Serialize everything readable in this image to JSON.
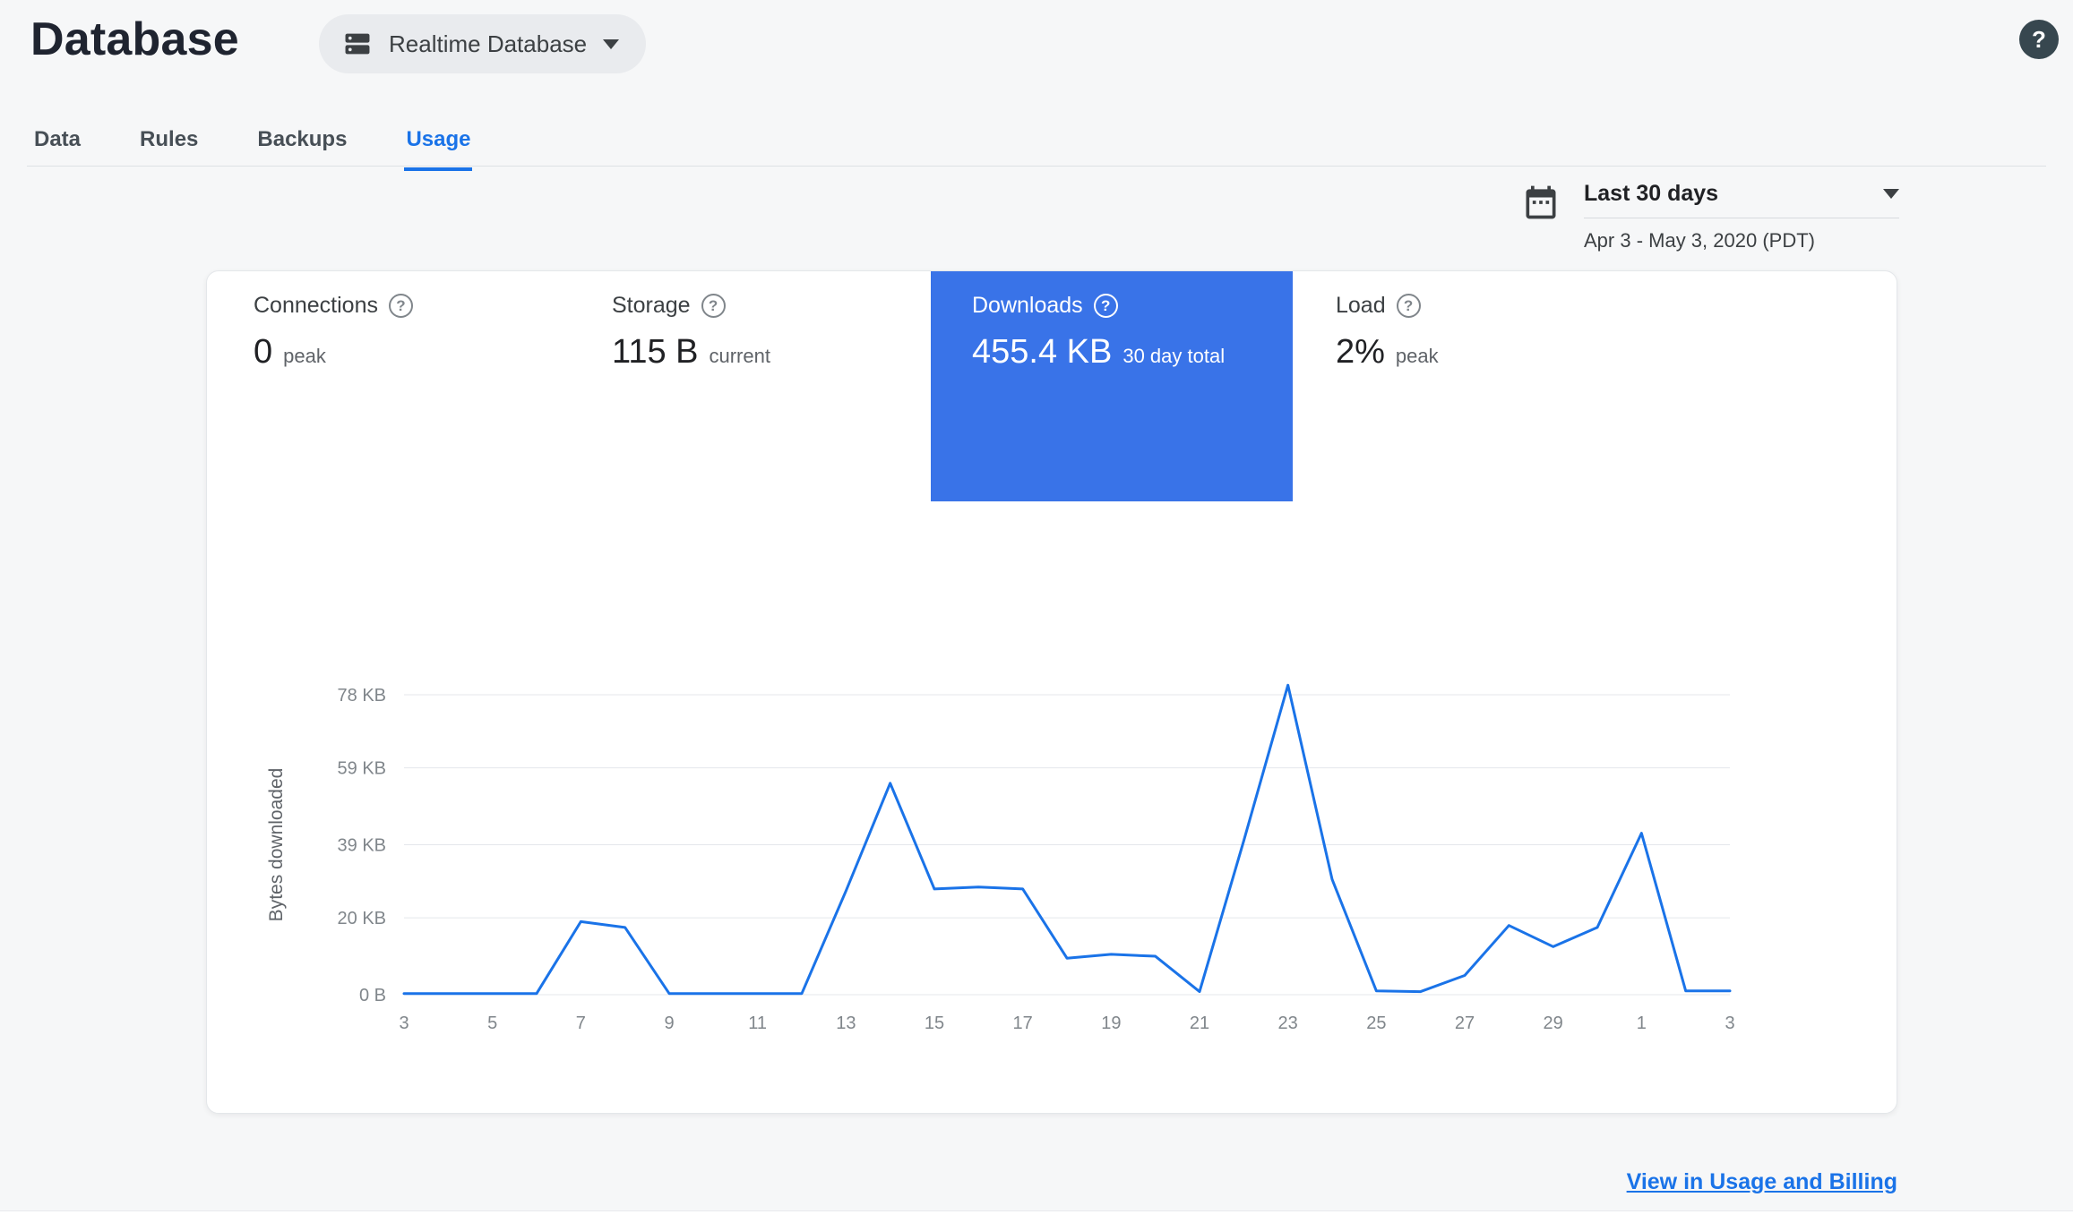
{
  "colors": {
    "accent": "#1a73e8",
    "selected_tile": "#3973e8",
    "page_bg": "#f6f7f8"
  },
  "header": {
    "title": "Database",
    "database_selector_label": "Realtime Database"
  },
  "icons": {
    "question_glyph": "?"
  },
  "tabs": [
    {
      "label": "Data",
      "active": false
    },
    {
      "label": "Rules",
      "active": false
    },
    {
      "label": "Backups",
      "active": false
    },
    {
      "label": "Usage",
      "active": true
    }
  ],
  "date_range": {
    "preset": "Last 30 days",
    "range": "Apr 3 - May 3, 2020 (PDT)"
  },
  "metrics": [
    {
      "label": "Connections",
      "value": "0",
      "unit": "peak",
      "selected": false
    },
    {
      "label": "Storage",
      "value": "115 B",
      "unit": "current",
      "selected": false
    },
    {
      "label": "Downloads",
      "value": "455.4 KB",
      "unit": "30 day total",
      "selected": true
    },
    {
      "label": "Load",
      "value": "2%",
      "unit": "peak",
      "selected": false
    }
  ],
  "chart_data": {
    "type": "line",
    "ylabel": "Bytes downloaded",
    "x_range": "Apr 3 - May 3, 2020",
    "x_tick_every": 2,
    "xticklabels": [
      "3",
      "5",
      "7",
      "9",
      "11",
      "13",
      "15",
      "17",
      "19",
      "21",
      "23",
      "25",
      "27",
      "29",
      "1",
      "3"
    ],
    "yticks": [
      {
        "label": "0 B",
        "value": 0
      },
      {
        "label": "20 KB",
        "value": 20
      },
      {
        "label": "39 KB",
        "value": 39
      },
      {
        "label": "59 KB",
        "value": 59
      },
      {
        "label": "78 KB",
        "value": 78
      }
    ],
    "ylim": [
      0,
      84
    ],
    "grid": true,
    "legend": "none",
    "values_kb": [
      0.3,
      0.3,
      0.3,
      0.3,
      19,
      17.5,
      0.3,
      0.3,
      0.3,
      0.3,
      27,
      55,
      27.5,
      28,
      27.5,
      9.5,
      10.5,
      10,
      0.8,
      40,
      80.5,
      30,
      1,
      0.8,
      5,
      18,
      12.5,
      17.5,
      42,
      1,
      1
    ]
  },
  "footer": {
    "link_label": "View in Usage and Billing"
  }
}
